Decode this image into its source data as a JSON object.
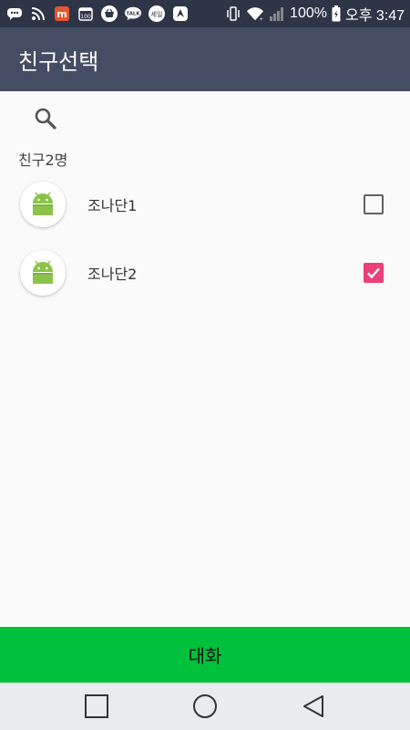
{
  "status_bar": {
    "battery": "100%",
    "time": "오후 3:47",
    "icons": [
      "chat-bubble-icon",
      "rss-icon",
      "app-m-icon",
      "calendar-100-icon",
      "shopping-basket-icon",
      "talk-icon",
      "sale-icon",
      "navigation-icon",
      "vibrate-icon",
      "wifi-icon",
      "signal-icon",
      "battery-icon"
    ],
    "talk_label": "TALK",
    "sale_label": "세일",
    "calendar_label": "100"
  },
  "app_bar": {
    "title": "친구선택",
    "color": "#444d63"
  },
  "search": {
    "icon": "search-icon"
  },
  "friends": {
    "count_label": "친구2명",
    "items": [
      {
        "name": "조나단1",
        "checked": false,
        "avatar": "android-icon"
      },
      {
        "name": "조나단2",
        "checked": true,
        "avatar": "android-icon"
      }
    ]
  },
  "chat_button": {
    "label": "대화",
    "color": "#00c13b"
  },
  "nav_bar": {
    "buttons": [
      "recents-square-icon",
      "home-circle-icon",
      "back-triangle-icon"
    ]
  },
  "colors": {
    "check_on": "#ec407a",
    "android_green": "#8bc34a"
  }
}
